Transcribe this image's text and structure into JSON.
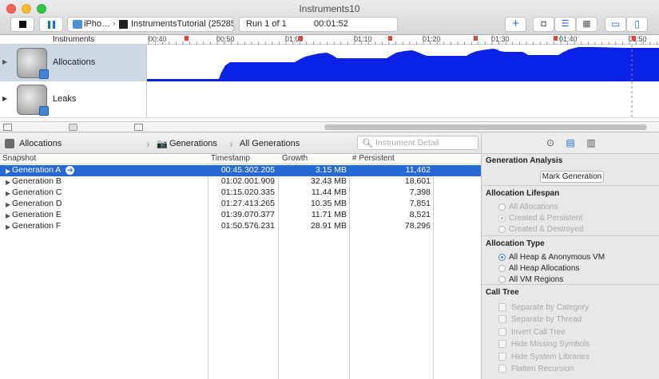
{
  "window": {
    "title": "Instruments10"
  },
  "toolbar": {
    "target_device": "iPho…",
    "target_process": "InstrumentsTutorial (25285)",
    "run_label": "Run 1 of 1",
    "run_time": "00:01:52",
    "add_label": "+"
  },
  "ruler": {
    "label": "Instruments",
    "ticks": [
      "00:40",
      "00:50",
      "01:00",
      "01:10",
      "01:20",
      "01:30",
      "01:40",
      "01:50"
    ]
  },
  "tracks": [
    {
      "name": "Allocations"
    },
    {
      "name": "Leaks"
    }
  ],
  "detail": {
    "crumb1": "Allocations",
    "crumb2": "Generations",
    "crumb3": "All Generations",
    "search_placeholder": "Instrument Detail"
  },
  "table": {
    "headers": {
      "snapshot": "Snapshot",
      "timestamp": "Timestamp",
      "growth": "Growth",
      "persistent": "# Persistent"
    },
    "rows": [
      {
        "name": "Generation A",
        "timestamp": "00:45.302.205",
        "growth": "3.15 MB",
        "persistent": "11,462"
      },
      {
        "name": "Generation B",
        "timestamp": "01:02.001.909",
        "growth": "32.43 MB",
        "persistent": "18,601"
      },
      {
        "name": "Generation C",
        "timestamp": "01:15.020.335",
        "growth": "11.44 MB",
        "persistent": "7,398"
      },
      {
        "name": "Generation D",
        "timestamp": "01:27.413.265",
        "growth": "10.35 MB",
        "persistent": "7,851"
      },
      {
        "name": "Generation E",
        "timestamp": "01:39.070.377",
        "growth": "11.71 MB",
        "persistent": "8,521"
      },
      {
        "name": "Generation F",
        "timestamp": "01:50.576.231",
        "growth": "28.91 MB",
        "persistent": "78,296"
      }
    ]
  },
  "inspector": {
    "generation_analysis": {
      "title": "Generation Analysis",
      "button": "Mark Generation"
    },
    "lifespan": {
      "title": "Allocation Lifespan",
      "options": [
        "All Allocations",
        "Created & Persistent",
        "Created & Destroyed"
      ],
      "selected": "Created & Persistent"
    },
    "type": {
      "title": "Allocation Type",
      "options": [
        "All Heap & Anonymous VM",
        "All Heap Allocations",
        "All VM Regions"
      ],
      "selected": "All Heap & Anonymous VM"
    },
    "call_tree": {
      "title": "Call Tree",
      "options": [
        "Separate by Category",
        "Separate by Thread",
        "Invert Call Tree",
        "Hide Missing Symbols",
        "Hide System Libraries",
        "Flatten Recursion"
      ]
    }
  },
  "colors": {
    "accent": "#2569d5",
    "graph_fill": "#0a22e6",
    "close": "#fc5f57",
    "minimize": "#fdbc2e",
    "zoom": "#33c748"
  }
}
